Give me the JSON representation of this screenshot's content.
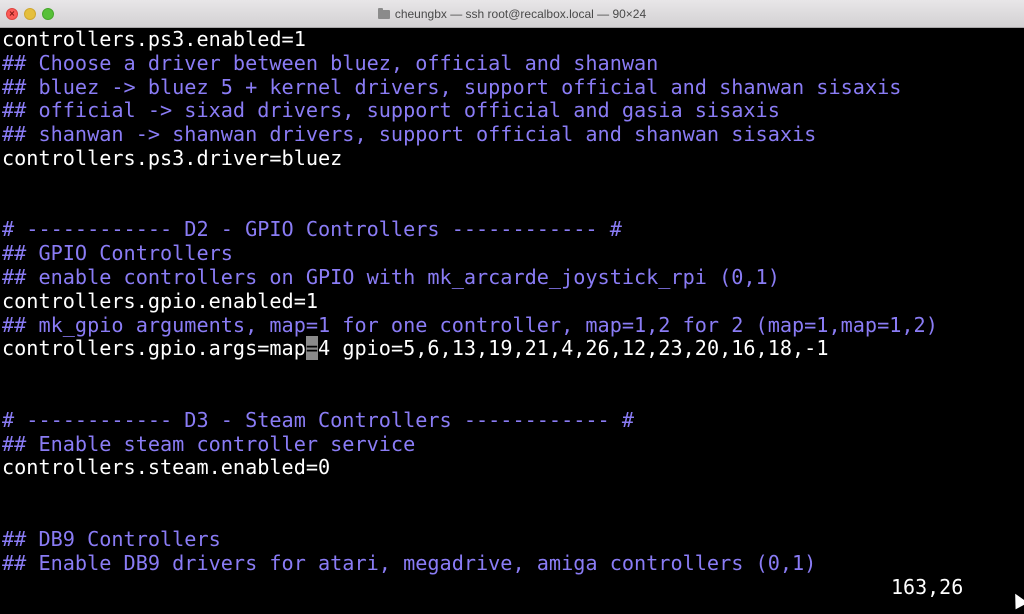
{
  "window": {
    "title": "cheungbx — ssh root@recalbox.local — 90×24"
  },
  "editor": {
    "lines": [
      {
        "type": "setting",
        "text": "controllers.ps3.enabled=1"
      },
      {
        "type": "comment",
        "text": "## Choose a driver between bluez, official and shanwan"
      },
      {
        "type": "comment",
        "text": "## bluez -> bluez 5 + kernel drivers, support official and shanwan sisaxis"
      },
      {
        "type": "comment",
        "text": "## official -> sixad drivers, support official and gasia sisaxis"
      },
      {
        "type": "comment",
        "text": "## shanwan -> shanwan drivers, support official and shanwan sisaxis"
      },
      {
        "type": "setting",
        "text": "controllers.ps3.driver=bluez"
      },
      {
        "type": "blank",
        "text": ""
      },
      {
        "type": "blank",
        "text": ""
      },
      {
        "type": "comment",
        "text": "# ------------ D2 - GPIO Controllers ------------ #"
      },
      {
        "type": "comment",
        "text": "## GPIO Controllers"
      },
      {
        "type": "comment",
        "text": "## enable controllers on GPIO with mk_arcarde_joystick_rpi (0,1)"
      },
      {
        "type": "setting",
        "text": "controllers.gpio.enabled=1"
      },
      {
        "type": "comment",
        "text": "## mk_gpio arguments, map=1 for one controller, map=1,2 for 2 (map=1,map=1,2)"
      },
      {
        "type": "setting",
        "text": "controllers.gpio.args=map=4 gpio=5,6,13,19,21,4,26,12,23,20,16,18,-1"
      },
      {
        "type": "blank",
        "text": ""
      },
      {
        "type": "blank",
        "text": ""
      },
      {
        "type": "comment",
        "text": "# ------------ D3 - Steam Controllers ------------ #"
      },
      {
        "type": "comment",
        "text": "## Enable steam controller service"
      },
      {
        "type": "setting",
        "text": "controllers.steam.enabled=0"
      },
      {
        "type": "blank",
        "text": ""
      },
      {
        "type": "blank",
        "text": ""
      },
      {
        "type": "comment",
        "text": "## DB9 Controllers"
      },
      {
        "type": "comment",
        "text": "## Enable DB9 drivers for atari, megadrive, amiga controllers (0,1)"
      }
    ],
    "cursor": {
      "line": 13,
      "column": 25
    }
  },
  "status": {
    "cursor_position": "163,26"
  },
  "colors": {
    "background": "#000000",
    "setting_text": "#ffffff",
    "comment_text": "#8a7cf5",
    "cursor_block": "#8a8a8a"
  }
}
